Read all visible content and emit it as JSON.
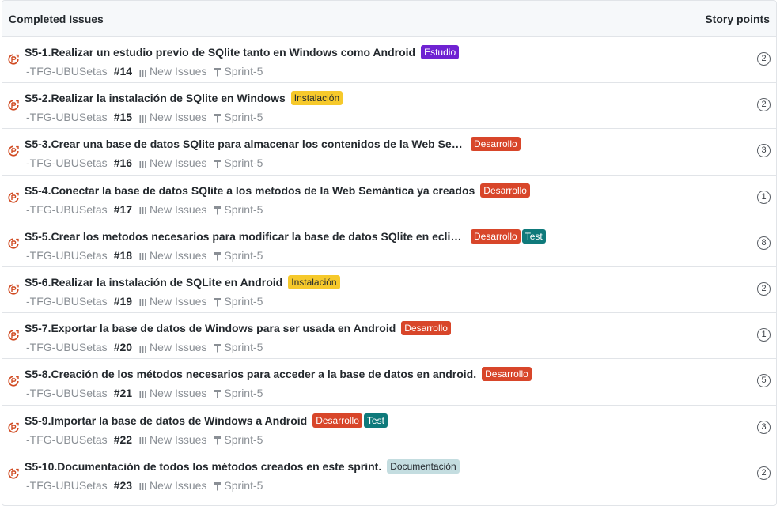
{
  "header": {
    "title": "Completed Issues",
    "story_points_label": "Story points"
  },
  "colors": {
    "Estudio": "#6f22d2",
    "Instalación": "#f6c92b",
    "Desarrollo": "#d8462a",
    "Test": "#0f7a7b",
    "Documentación": "#c4dde0",
    "issue_icon": "#d04a21"
  },
  "icons": {
    "issue": "closed-issue-icon",
    "pipeline": "pipeline-icon",
    "milestone": "milestone-icon"
  },
  "issues": [
    {
      "title": "S5-1.Realizar un estudio previo de SQlite tanto en Windows como Android",
      "labels": [
        "Estudio"
      ],
      "repo": "-TFG-UBUSetas",
      "number": "#14",
      "pipeline": "New Issues",
      "milestone": "Sprint-5",
      "points": "2"
    },
    {
      "title": "S5-2.Realizar la instalación de SQlite en Windows",
      "labels": [
        "Instalación"
      ],
      "repo": "-TFG-UBUSetas",
      "number": "#15",
      "pipeline": "New Issues",
      "milestone": "Sprint-5",
      "points": "2"
    },
    {
      "title": "S5-3.Crear una base de datos SQlite para almacenar los contenidos de la Web Sem…",
      "labels": [
        "Desarrollo"
      ],
      "repo": "-TFG-UBUSetas",
      "number": "#16",
      "pipeline": "New Issues",
      "milestone": "Sprint-5",
      "points": "3"
    },
    {
      "title": "S5-4.Conectar la base de datos SQlite a los metodos de la Web Semántica ya creados",
      "labels": [
        "Desarrollo"
      ],
      "repo": "-TFG-UBUSetas",
      "number": "#17",
      "pipeline": "New Issues",
      "milestone": "Sprint-5",
      "points": "1"
    },
    {
      "title": "S5-5.Crear los metodos necesarios para modificar la base de datos SQlite en eclips…",
      "labels": [
        "Desarrollo",
        "Test"
      ],
      "repo": "-TFG-UBUSetas",
      "number": "#18",
      "pipeline": "New Issues",
      "milestone": "Sprint-5",
      "points": "8"
    },
    {
      "title": "S5-6.Realizar la instalación de SQLite en Android",
      "labels": [
        "Instalación"
      ],
      "repo": "-TFG-UBUSetas",
      "number": "#19",
      "pipeline": "New Issues",
      "milestone": "Sprint-5",
      "points": "2"
    },
    {
      "title": "S5-7.Exportar la base de datos de Windows para ser usada en Android",
      "labels": [
        "Desarrollo"
      ],
      "repo": "-TFG-UBUSetas",
      "number": "#20",
      "pipeline": "New Issues",
      "milestone": "Sprint-5",
      "points": "1"
    },
    {
      "title": "S5-8.Creación de los métodos necesarios para acceder a la base de datos en android.",
      "labels": [
        "Desarrollo"
      ],
      "repo": "-TFG-UBUSetas",
      "number": "#21",
      "pipeline": "New Issues",
      "milestone": "Sprint-5",
      "points": "5"
    },
    {
      "title": "S5-9.Importar la base de datos de Windows a Android",
      "labels": [
        "Desarrollo",
        "Test"
      ],
      "repo": "-TFG-UBUSetas",
      "number": "#22",
      "pipeline": "New Issues",
      "milestone": "Sprint-5",
      "points": "3"
    },
    {
      "title": "S5-10.Documentación de todos los métodos creados en este sprint.",
      "labels": [
        "Documentación"
      ],
      "repo": "-TFG-UBUSetas",
      "number": "#23",
      "pipeline": "New Issues",
      "milestone": "Sprint-5",
      "points": "2"
    }
  ]
}
